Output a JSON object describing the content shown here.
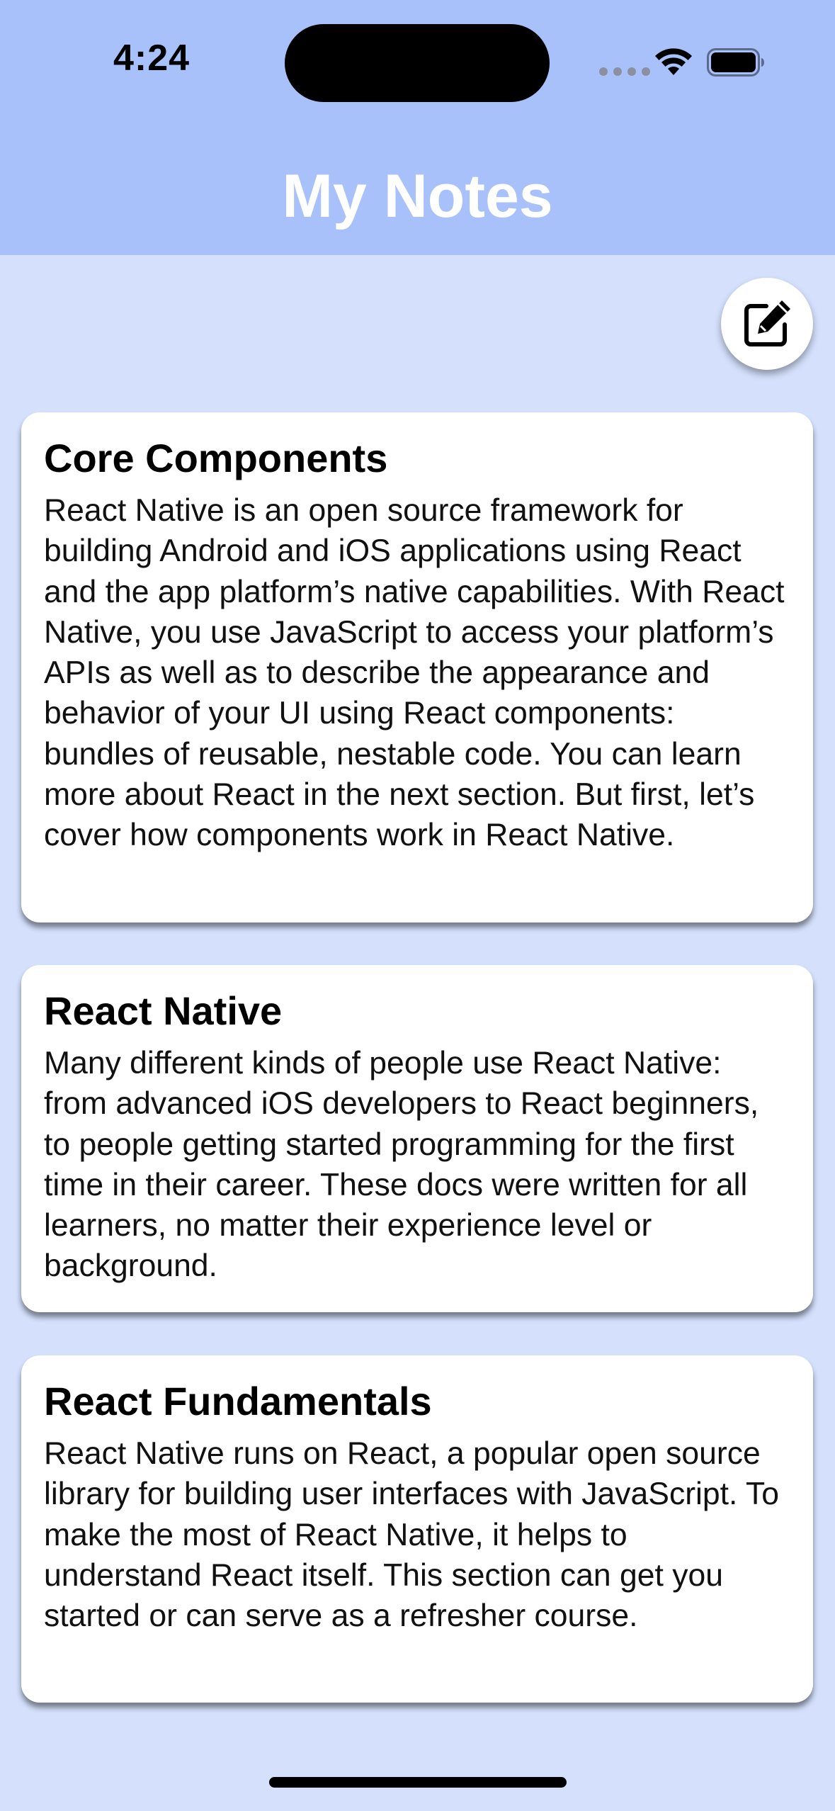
{
  "status_bar": {
    "time": "4:24"
  },
  "header": {
    "title": "My Notes",
    "background_color": "#a8c1fb"
  },
  "toolbar": {
    "edit_icon": "edit-note-icon"
  },
  "notes": [
    {
      "title": "Core Components",
      "body": "React Native is an open source framework for building Android and iOS applications using React and the app platform’s native capabilities. With React Native, you use JavaScript to access your platform’s APIs as well as to describe the appearance and behavior of your UI using React components: bundles of reusable, nestable code. You can learn more about React in the next section. But first, let’s cover how components work in React Native."
    },
    {
      "title": "React Native",
      "body": "Many different kinds of people use React Native: from advanced iOS developers to React beginners, to people getting started programming for the first time in their career. These docs were written for all learners, no matter their experience level or background."
    },
    {
      "title": "React Fundamentals",
      "body": "React Native runs on React, a popular open source library for building user interfaces with JavaScript. To make the most of React Native, it helps to understand React itself. This section can get you started or can serve as a refresher course."
    }
  ],
  "colors": {
    "page_background": "#d4e0fc",
    "card_background": "#ffffff"
  }
}
